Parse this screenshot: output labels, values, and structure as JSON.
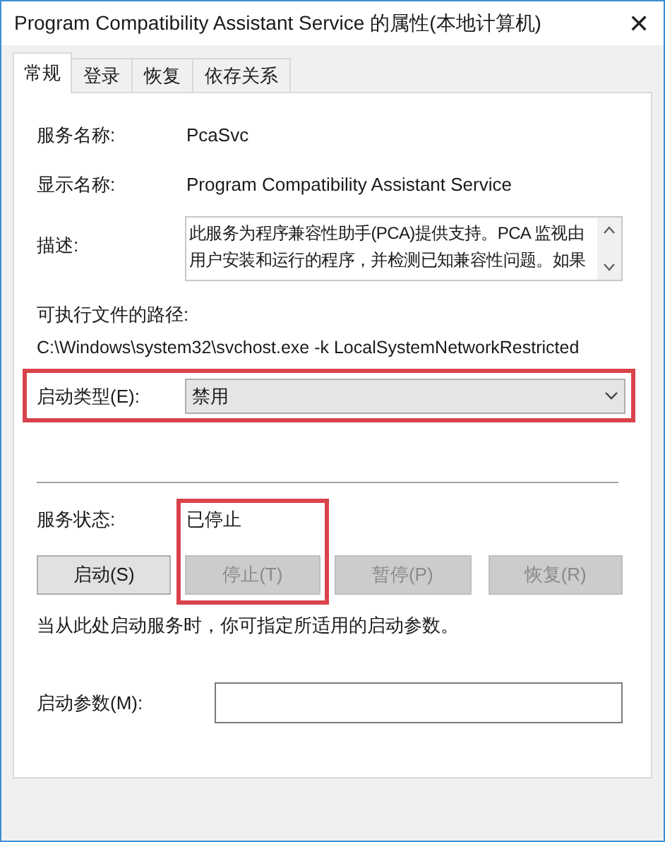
{
  "window": {
    "title": "Program Compatibility Assistant Service 的属性(本地计算机)",
    "close": "✕"
  },
  "tabs": [
    {
      "label": "常规",
      "selected": true
    },
    {
      "label": "登录",
      "selected": false
    },
    {
      "label": "恢复",
      "selected": false
    },
    {
      "label": "依存关系",
      "selected": false
    }
  ],
  "fields": [
    {
      "label": "服务名称:",
      "value": "PcaSvc"
    },
    {
      "label": "显示名称:",
      "value": "Program Compatibility Assistant Service"
    }
  ],
  "description": {
    "label": "描述:",
    "lines": [
      "此服务为程序兼容性助手(PCA)提供支持。PCA 监视由",
      "用户安装和运行的程序，并检测已知兼容性问题。如果"
    ]
  },
  "path": {
    "label": "可执行文件的路径:",
    "value": "C:\\Windows\\system32\\svchost.exe -k LocalSystemNetworkRestricted"
  },
  "startup_type": {
    "label": "启动类型(E):",
    "value": "禁用"
  },
  "service_status": {
    "label": "服务状态:",
    "value": "已停止"
  },
  "buttons": [
    {
      "label": "启动(S)",
      "disabled": false
    },
    {
      "label": "停止(T)",
      "disabled": true
    },
    {
      "label": "暂停(P)",
      "disabled": true
    },
    {
      "label": "恢复(R)",
      "disabled": true
    }
  ],
  "hint": "当从此处启动服务时，你可指定所适用的启动参数。",
  "start_params": {
    "label": "启动参数(M):"
  }
}
